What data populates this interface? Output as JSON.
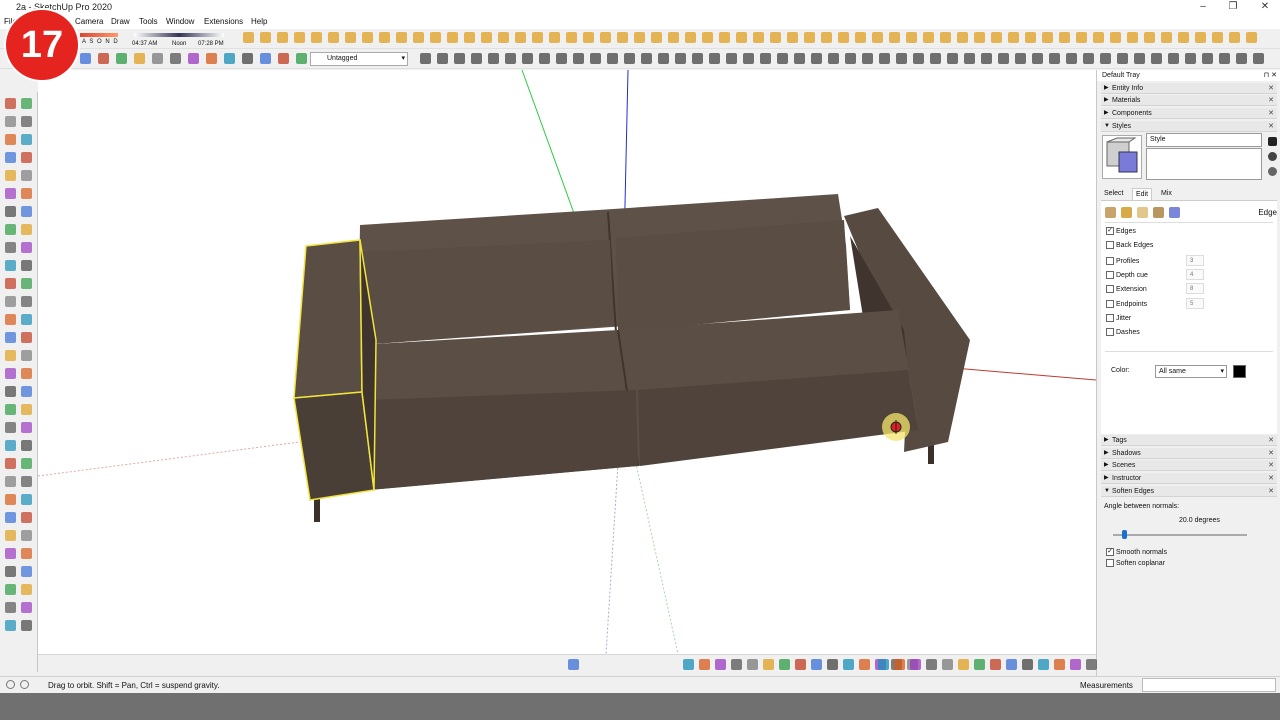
{
  "window": {
    "title": "2a - SketchUp Pro 2020",
    "minimize": "–",
    "maximize": "❐",
    "close": "✕"
  },
  "badge": {
    "number": "17"
  },
  "menu": [
    "File",
    "Camera",
    "Draw",
    "Tools",
    "Window",
    "Extensions",
    "Help"
  ],
  "shadows": {
    "months": "A S O N D",
    "time_start": "04:37 AM",
    "time_mid": "Noon",
    "time_end": "07:28 PM"
  },
  "tag_select": {
    "value": "Untagged"
  },
  "status": {
    "hint": "Drag to orbit. Shift = Pan, Ctrl = suspend gravity."
  },
  "measurements": {
    "label": "Measurements",
    "value": ""
  },
  "tray": {
    "title": "Default Tray",
    "pin": "⊓ ✕",
    "panels_top": [
      {
        "label": "Entity Info",
        "open": false
      },
      {
        "label": "Materials",
        "open": false
      },
      {
        "label": "Components",
        "open": false
      },
      {
        "label": "Styles",
        "open": true
      }
    ],
    "style": {
      "name": "Style",
      "tabs": [
        "Select",
        "Edit",
        "Mix"
      ],
      "section": "Edge"
    },
    "edge_settings": [
      {
        "label": "Edges",
        "checked": true,
        "value": ""
      },
      {
        "label": "Back Edges",
        "checked": false,
        "value": ""
      },
      {
        "label": "Profiles",
        "checked": false,
        "value": "3"
      },
      {
        "label": "Depth cue",
        "checked": false,
        "value": "4"
      },
      {
        "label": "Extension",
        "checked": false,
        "value": "8"
      },
      {
        "label": "Endpoints",
        "checked": false,
        "value": "5"
      },
      {
        "label": "Jitter",
        "checked": false,
        "value": ""
      },
      {
        "label": "Dashes",
        "checked": false,
        "value": ""
      }
    ],
    "color": {
      "label": "Color:",
      "value": "All same",
      "swatch": "#000000"
    },
    "panels_bottom": [
      {
        "label": "Tags",
        "open": false
      },
      {
        "label": "Shadows",
        "open": false
      },
      {
        "label": "Scenes",
        "open": false
      },
      {
        "label": "Instructor",
        "open": false
      },
      {
        "label": "Soften Edges",
        "open": true
      }
    ],
    "soften": {
      "angle_label": "Angle between normals:",
      "angle_value": "20.0  degrees",
      "angle_degrees": 20.0,
      "smooth_normals": {
        "label": "Smooth normals",
        "checked": true
      },
      "soften_coplanar": {
        "label": "Soften coplanar",
        "checked": false
      }
    }
  },
  "colors": {
    "sofa": "#5e5148",
    "sofa_dark": "#4a3f37",
    "selection": "#f1e43a",
    "axis_red": "#c0392b",
    "axis_green": "#2ecc40",
    "axis_blue": "#2031c8"
  }
}
